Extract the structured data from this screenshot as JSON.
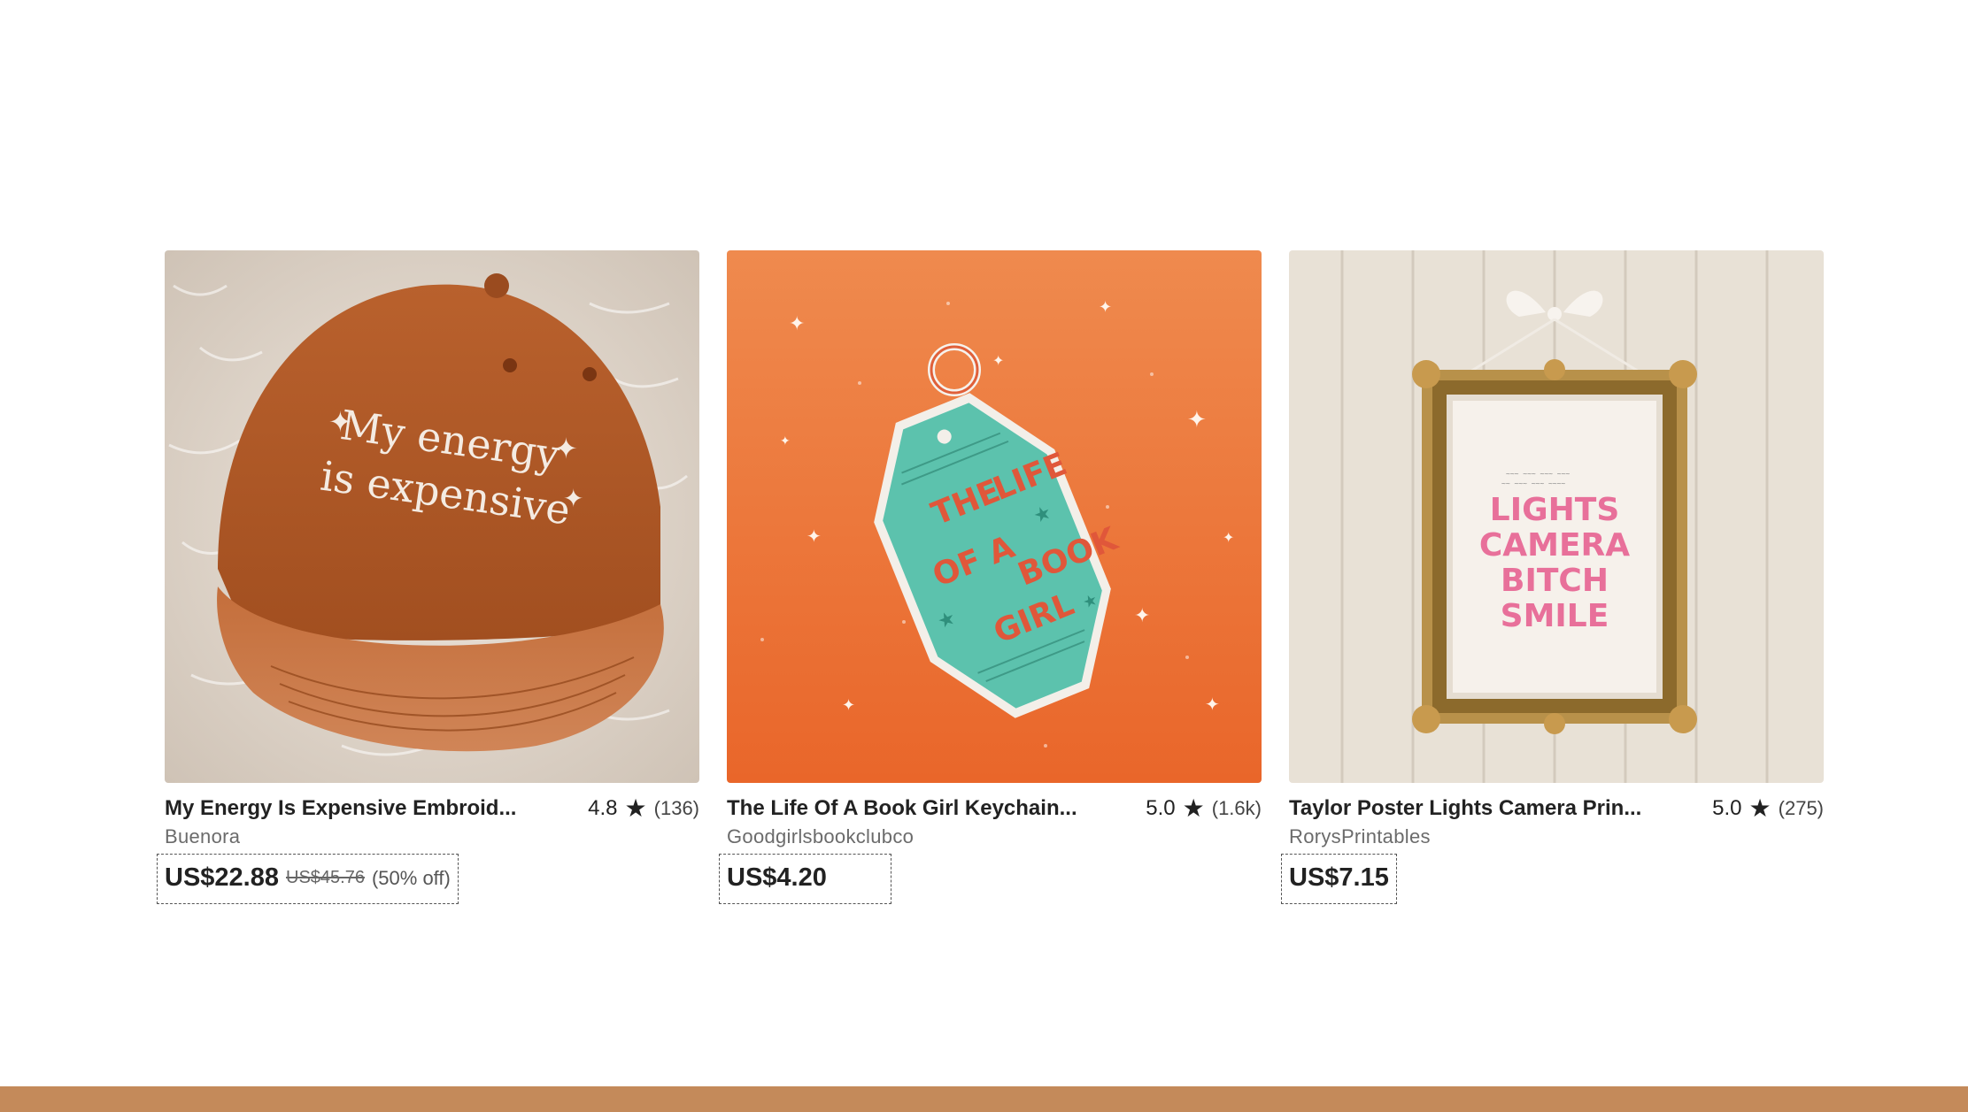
{
  "colors": {
    "footer": "#c48a5a",
    "text": "#222222",
    "shop": "#6b6b6b"
  },
  "listings": [
    {
      "title": "My Energy Is Expensive Embroid...",
      "rating": "4.8",
      "reviews": "(136)",
      "shop": "Buenora",
      "price": "US$22.88",
      "original_price": "US$45.76",
      "discount": "(50% off)",
      "image_text": [
        "My energy",
        "is expensive"
      ]
    },
    {
      "title": "The Life Of A Book Girl Keychain...",
      "rating": "5.0",
      "reviews": "(1.6k)",
      "shop": "Goodgirlsbookclubco",
      "price": "US$4.20",
      "image_text": [
        "THE",
        "LIFE",
        "OF A",
        "BOOK",
        "GIRL"
      ]
    },
    {
      "title": "Taylor Poster Lights Camera Prin...",
      "rating": "5.0",
      "reviews": "(275)",
      "shop": "RorysPrintables",
      "price": "US$7.15",
      "image_text": [
        "LIGHTS",
        "CAMERA",
        "BITCH",
        "SMILE"
      ]
    }
  ]
}
